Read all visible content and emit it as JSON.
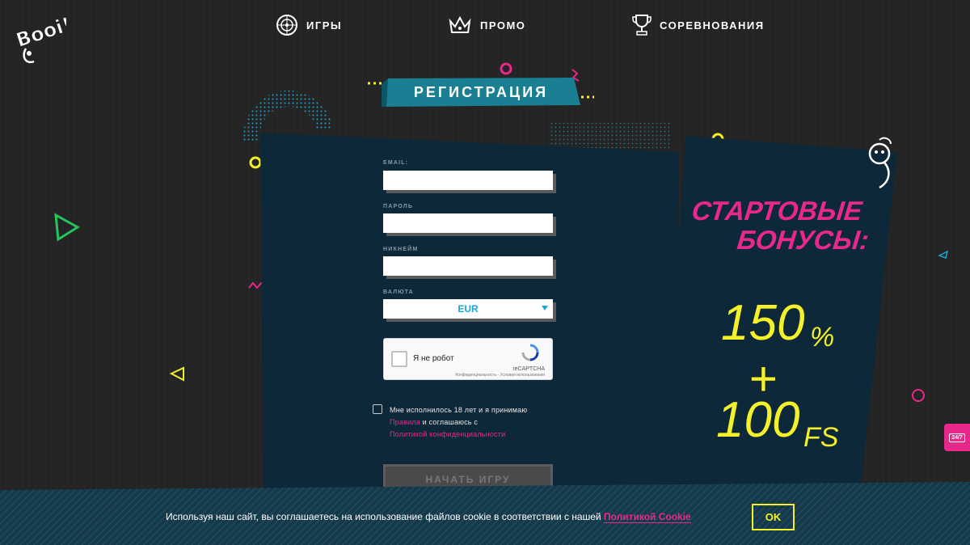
{
  "brand": {
    "logo_text": "Booi!"
  },
  "nav": {
    "items": [
      {
        "label": "ИГРЫ",
        "icon": "roulette-icon"
      },
      {
        "label": "ПРОМО",
        "icon": "crown-icon"
      },
      {
        "label": "СОРЕВНОВАНИЯ",
        "icon": "trophy-icon"
      }
    ]
  },
  "registration": {
    "title": "РЕГИСТРАЦИЯ",
    "email_label": "EMAIL:",
    "email_value": "",
    "password_label": "ПАРОЛЬ",
    "password_value": "",
    "nickname_label": "НИКНЕЙМ",
    "nickname_value": "",
    "currency_label": "ВАЛЮТА",
    "currency_value": "EUR",
    "captcha": {
      "label": "Я не робот",
      "brand": "reCAPTCHA",
      "terms": "Конфиденциальность - Условия использования"
    },
    "agree": {
      "line1": "Мне исполнилось 18 лет и я принимаю",
      "rules_link": "Правила",
      "line2_rest": " и соглашаюсь с",
      "privacy_link": "Политикой конфиденциальности"
    },
    "submit_label": "НАЧАТЬ ИГРУ"
  },
  "bonus": {
    "title_line1": "СТАРТОВЫЕ",
    "title_line2": "БОНУСЫ:",
    "percent_value": "150",
    "percent_sign": "%",
    "plus": "+",
    "spins_value": "100",
    "spins_unit": "FS"
  },
  "support": {
    "label": "24/7"
  },
  "cookie": {
    "text": "Используя наш сайт, вы соглашаетесь на использование файлов cookie в соответствии с нашей ",
    "link": "Политикой Cookie",
    "ok_label": "OK"
  },
  "colors": {
    "background": "#242424",
    "panel": "#0d2838",
    "accent_pink": "#e8288a",
    "accent_yellow": "#f4f02a",
    "accent_teal": "#1a7f93",
    "accent_green": "#22c55e"
  }
}
